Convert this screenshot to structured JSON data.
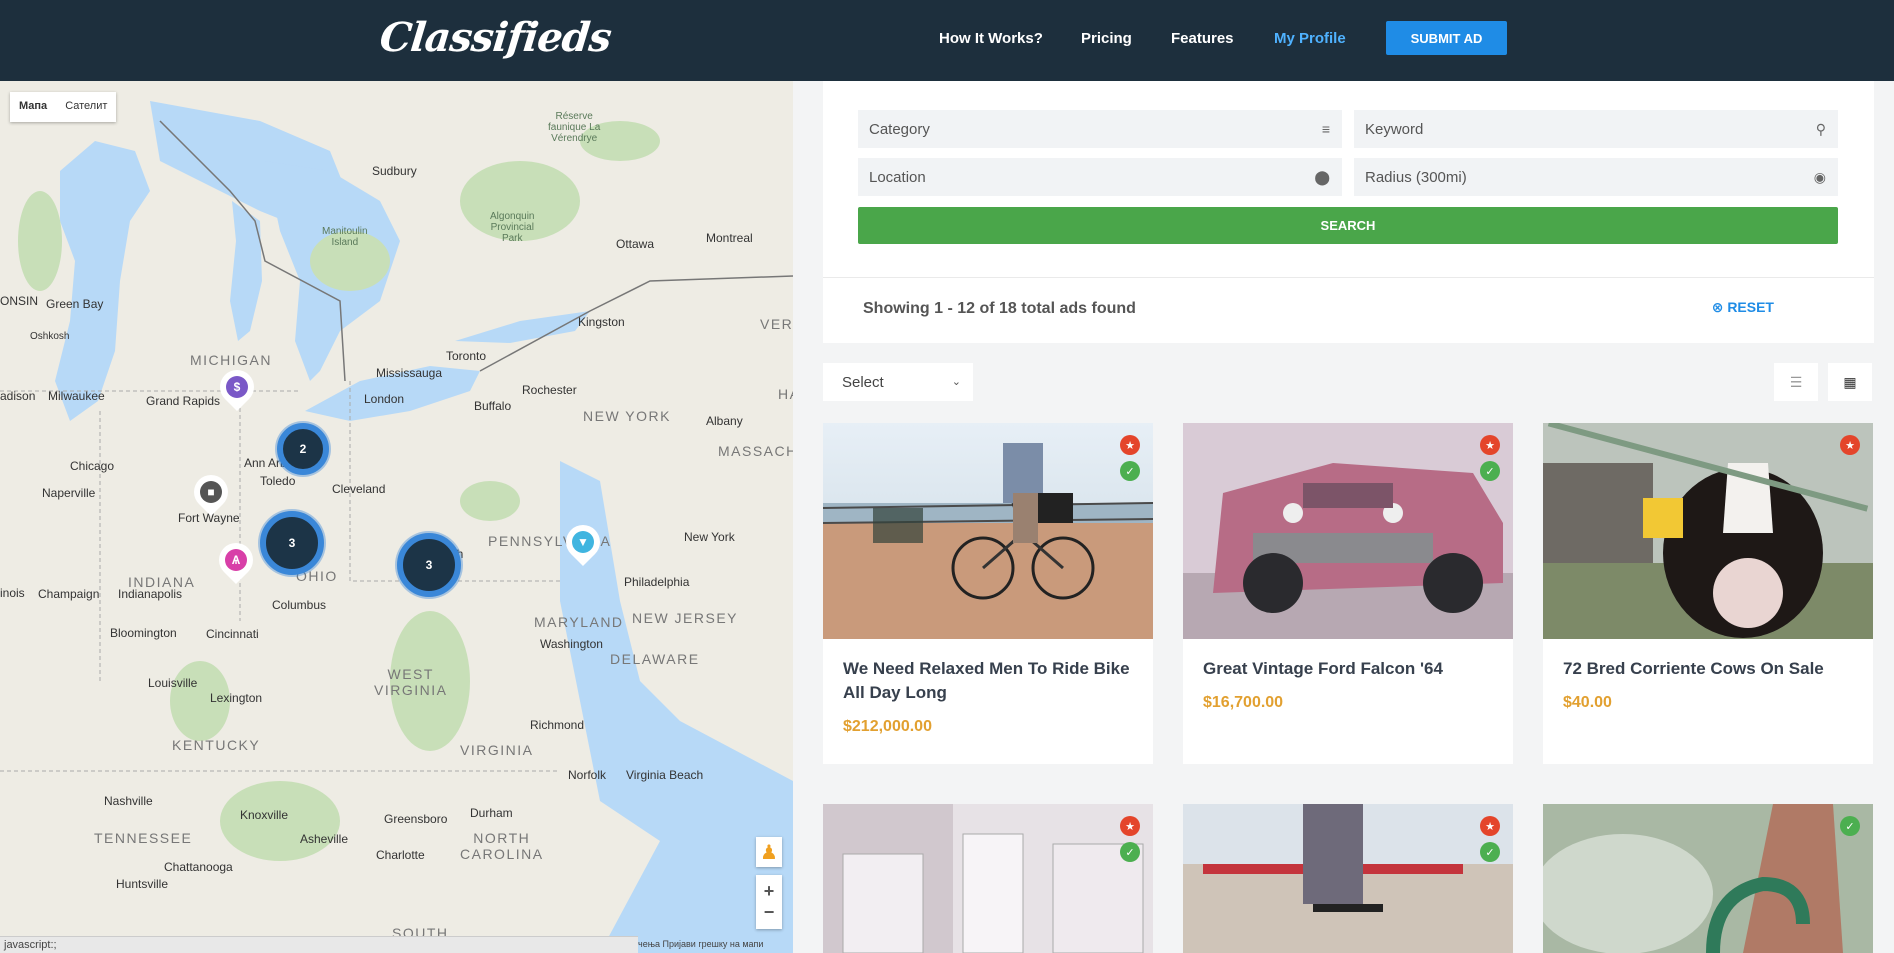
{
  "header": {
    "logo": "Classifieds",
    "nav": [
      "How It Works?",
      "Pricing",
      "Features",
      "My Profile"
    ],
    "submit_label": "SUBMIT AD"
  },
  "map": {
    "toggle": [
      "Мапа",
      "Сателит"
    ],
    "labels": {
      "sudbury": "Sudbury",
      "ottawa": "Ottawa",
      "montreal": "Montreal",
      "green_bay": "Green Bay",
      "oshkosh": "Oshkosh",
      "michigan": "MICHIGAN",
      "milwaukee": "Milwaukee",
      "grand_rapids": "Grand Rapids",
      "madison": "adison",
      "chicago": "Chicago",
      "naperville": "Naperville",
      "ann_arbor": "Ann Arb",
      "toledo": "Toledo",
      "fort_wayne": "Fort Wayne",
      "cleveland": "Cleveland",
      "toronto": "Toronto",
      "mississauga": "Mississauga",
      "london": "London",
      "kingston": "Kingston",
      "rochester": "Rochester",
      "buffalo": "Buffalo",
      "new_york_state": "NEW YORK",
      "albany": "Albany",
      "massach": "MASSACH",
      "vermo": "VERMO",
      "ha": "HA",
      "pennsylvania": "PENNSYLVANIA",
      "new_york_city": "New York",
      "philadelphia": "Philadelphia",
      "indiana": "INDIANA",
      "indianapolis": "Indianapolis",
      "ohio": "OHIO",
      "columbus": "Columbus",
      "illinois": "INOIS",
      "champaign": "Champaign",
      "bloomington": "Bloomington",
      "cincinnati": "Cincinnati",
      "maryland": "MARYLAND",
      "new_jersey": "NEW JERSEY",
      "washington": "Washington",
      "delaware": "DELAWARE",
      "west_virginia": "WEST\nVIRGINIA",
      "louisville": "Louisville",
      "lexington": "Lexington",
      "kentucky": "KENTUCKY",
      "virginia": "VIRGINIA",
      "richmond": "Richmond",
      "norfolk": "Norfolk",
      "virginia_beach": "Virginia Beach",
      "nashville": "Nashville",
      "tennessee": "TENNESSEE",
      "knoxville": "Knoxville",
      "chattanooga": "Chattanooga",
      "huntsville": "Huntsville",
      "asheville": "Asheville",
      "greensboro": "Greensboro",
      "durham": "Durham",
      "north_carolina": "NORTH\nCAROLINA",
      "charlotte": "Charlotte",
      "south": "SOUTH",
      "gh": "gh",
      "oinsin": "ONSIN",
      "inois2": "inois",
      "reserve": "Réserve\nfaunique La\nVérendrye",
      "manitoulin": "Manitoulin\nIsland",
      "algonquin": "Algonquin\nProvincial\nPark"
    },
    "clusters": [
      "2",
      "3",
      "3"
    ],
    "status_bar": "javascript:;",
    "footer": "чења   Пријави грешку на мапи"
  },
  "search": {
    "category_placeholder": "Category",
    "keyword_placeholder": "Keyword",
    "location_placeholder": "Location",
    "radius_placeholder": "Radius (300mi)",
    "search_label": "SEARCH"
  },
  "results": {
    "summary": "Showing 1 - 12 of 18 total ads found",
    "reset_label": "RESET"
  },
  "sort": {
    "selected": "Select"
  },
  "listings": [
    {
      "title": "We Need Relaxed Men To Ride Bike All Day Long",
      "price": "$212,000.00"
    },
    {
      "title": "Great Vintage Ford Falcon '64",
      "price": "$16,700.00"
    },
    {
      "title": "72 Bred Corriente Cows On Sale",
      "price": "$40.00"
    }
  ],
  "colors": {
    "header_bg": "#1d2f3d",
    "accent": "#1f8ce6",
    "search_green": "#4aa64a",
    "price": "#e2a030",
    "star_badge": "#e4452b",
    "check_badge": "#4caf50"
  }
}
